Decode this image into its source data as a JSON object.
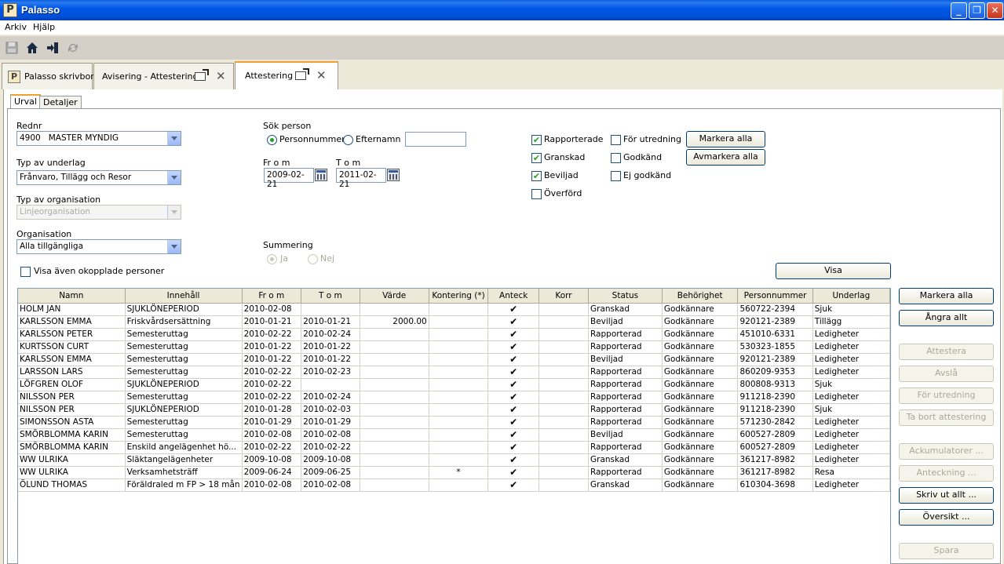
{
  "window": {
    "title": "Palasso",
    "app_icon": "P"
  },
  "menu": [
    "Arkiv",
    "Hjälp"
  ],
  "toolbar_icons": [
    "save-icon",
    "home-icon",
    "exit-icon",
    "refresh-icon"
  ],
  "doc_tabs": [
    {
      "label": "Palasso skrivbord"
    },
    {
      "label": "Avisering - Attestering"
    },
    {
      "label": "Attestering"
    }
  ],
  "sub_tabs": [
    "Urval",
    "Detaljer"
  ],
  "form": {
    "rednr_label": "Rednr",
    "rednr_value": "4900   MASTER MYNDIG",
    "typ_underlag_label": "Typ av underlag",
    "typ_underlag_value": "Frånvaro, Tillägg och Resor",
    "typ_org_label": "Typ av organisation",
    "typ_org_value": "Linjeorganisation",
    "org_label": "Organisation",
    "org_value": "Alla tillgängliga",
    "okopplade_label": "Visa även okopplade personer",
    "sok_person_label": "Sök person",
    "radio_personnummer": "Personnummer",
    "radio_efternamn": "Efternamn",
    "search_value": "",
    "from_label": "Fr o m",
    "from_value": "2009-02-21",
    "tom_label": "T o m",
    "tom_value": "2011-02-21",
    "summering_label": "Summering",
    "radio_ja": "Ja",
    "radio_nej": "Nej",
    "check_rapporterade": "Rapporterade",
    "check_granskad": "Granskad",
    "check_beviljad": "Beviljad",
    "check_overford": "Överförd",
    "check_for_utredning": "För utredning",
    "check_godkand": "Godkänd",
    "check_ej_godkand": "Ej godkänd",
    "btn_markera_alla": "Markera alla",
    "btn_avmarkera_alla": "Avmarkera alla",
    "btn_visa": "Visa"
  },
  "checked_mark": "✔",
  "grid": {
    "columns": [
      "Namn",
      "Innehåll",
      "Fr o m",
      "T o m",
      "Värde",
      "Kontering (*)",
      "Anteck",
      "Korr",
      "Status",
      "Behörighet",
      "Personnummer",
      "Underlag"
    ],
    "rows": [
      [
        "HOLM JAN",
        "SJUKLÖNEPERIOD",
        "2010-02-08",
        "",
        "",
        "",
        "✔",
        "",
        "Granskad",
        "Godkännare",
        "560722-2394",
        "Sjuk"
      ],
      [
        "KARLSSON EMMA",
        "Friskvårdsersättning",
        "2010-01-21",
        "2010-01-21",
        "2000.00",
        "",
        "✔",
        "",
        "Beviljad",
        "Godkännare",
        "920121-2389",
        "Tillägg"
      ],
      [
        "KARLSSON PETER",
        "Semesteruttag",
        "2010-02-22",
        "2010-02-24",
        "",
        "",
        "✔",
        "",
        "Rapporterad",
        "Godkännare",
        "451010-6331",
        "Ledigheter"
      ],
      [
        "KURTSSON CURT",
        "Semesteruttag",
        "2010-01-22",
        "2010-01-22",
        "",
        "",
        "✔",
        "",
        "Rapporterad",
        "Godkännare",
        "530323-1855",
        "Ledigheter"
      ],
      [
        "KARLSSON EMMA",
        "Semesteruttag",
        "2010-01-22",
        "2010-01-22",
        "",
        "",
        "✔",
        "",
        "Beviljad",
        "Godkännare",
        "920121-2389",
        "Ledigheter"
      ],
      [
        "LARSSON LARS",
        "Semesteruttag",
        "2010-02-22",
        "2010-02-23",
        "",
        "",
        "✔",
        "",
        "Rapporterad",
        "Godkännare",
        "860209-9353",
        "Ledigheter"
      ],
      [
        "LÖFGREN OLOF",
        "SJUKLÖNEPERIOD",
        "2010-02-22",
        "",
        "",
        "",
        "✔",
        "",
        "Rapporterad",
        "Godkännare",
        "800808-9313",
        "Sjuk"
      ],
      [
        "NILSSON PER",
        "Semesteruttag",
        "2010-02-22",
        "2010-02-24",
        "",
        "",
        "✔",
        "",
        "Rapporterad",
        "Godkännare",
        "911218-2390",
        "Ledigheter"
      ],
      [
        "NILSSON PER",
        "SJUKLÖNEPERIOD",
        "2010-01-28",
        "2010-02-03",
        "",
        "",
        "✔",
        "",
        "Rapporterad",
        "Godkännare",
        "911218-2390",
        "Sjuk"
      ],
      [
        "SIMONSSON ASTA",
        "Semesteruttag",
        "2010-01-29",
        "2010-01-29",
        "",
        "",
        "✔",
        "",
        "Rapporterad",
        "Godkännare",
        "571230-2842",
        "Ledigheter"
      ],
      [
        "SMÖRBLOMMA KARIN",
        "Semesteruttag",
        "2010-02-08",
        "2010-02-08",
        "",
        "",
        "✔",
        "",
        "Beviljad",
        "Godkännare",
        "600527-2809",
        "Ledigheter"
      ],
      [
        "SMÖRBLOMMA KARIN",
        "Enskild angelägenhet hö...",
        "2010-02-22",
        "2010-02-22",
        "",
        "",
        "✔",
        "",
        "Rapporterad",
        "Godkännare",
        "600527-2809",
        "Ledigheter"
      ],
      [
        "WW ULRIKA",
        "Släktangelägenheter",
        "2009-10-08",
        "2009-10-08",
        "",
        "",
        "✔",
        "",
        "Granskad",
        "Godkännare",
        "361217-8982",
        "Ledigheter"
      ],
      [
        "WW ULRIKA",
        "Verksamhetsträff",
        "2009-06-24",
        "2009-06-25",
        "",
        "*",
        "✔",
        "",
        "Rapporterad",
        "Godkännare",
        "361217-8982",
        "Resa"
      ],
      [
        "ÖLUND THOMAS",
        "Föräldraled m FP > 18 mån",
        "2010-02-08",
        "2010-02-08",
        "",
        "",
        "✔",
        "",
        "Granskad",
        "Godkännare",
        "610304-3698",
        "Ledigheter"
      ]
    ]
  },
  "side_buttons": {
    "markera_alla": "Markera alla",
    "angra_allt": "Ångra allt",
    "attestera": "Attestera",
    "avsla": "Avslå",
    "for_utredning": "För utredning",
    "ta_bort": "Ta bort attestering",
    "ackumulatorer": "Ackumulatorer ...",
    "anteckning": "Anteckning ...",
    "skriv_ut": "Skriv ut allt ...",
    "oversikt": "Översikt ...",
    "spara": "Spara"
  }
}
